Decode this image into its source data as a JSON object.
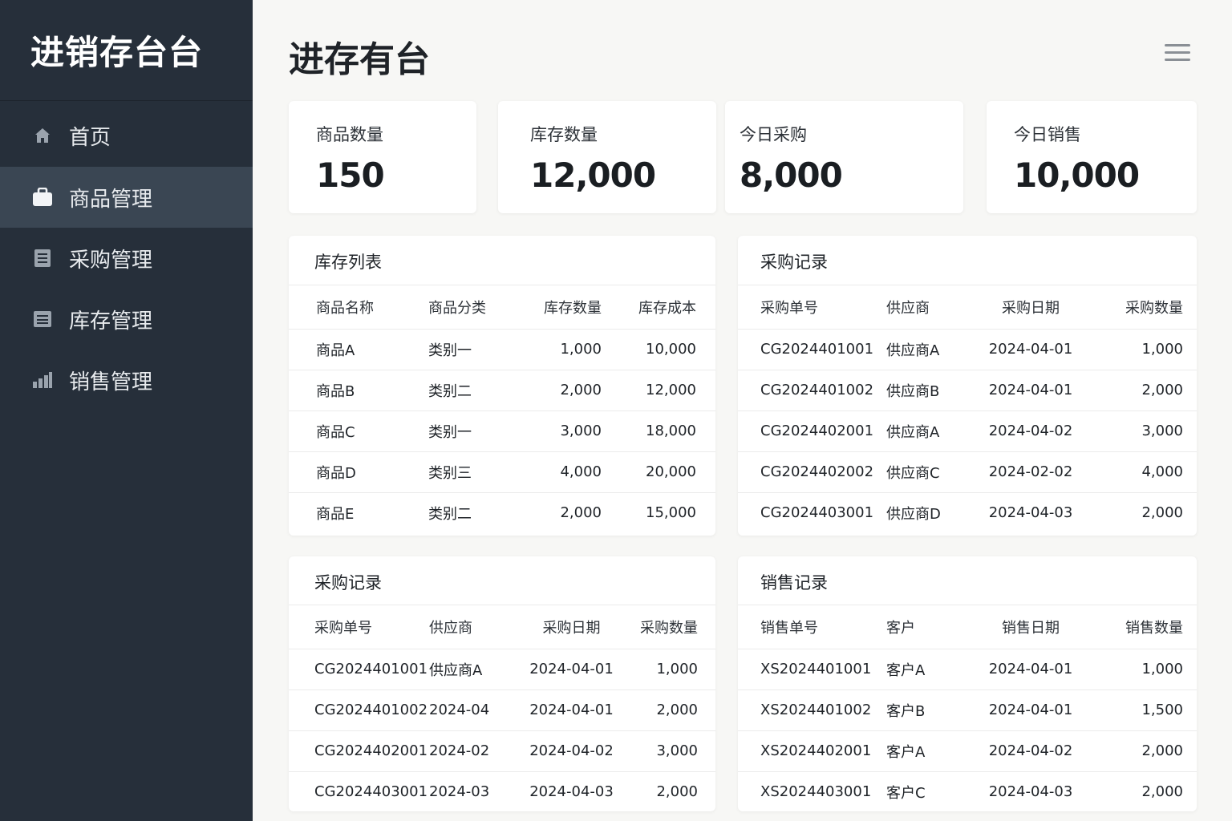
{
  "sidebar": {
    "brand": "进销存台台",
    "items": [
      {
        "label": "首页",
        "icon": "home-icon"
      },
      {
        "label": "商品管理",
        "icon": "briefcase-icon"
      },
      {
        "label": "采购管理",
        "icon": "document-icon"
      },
      {
        "label": "库存管理",
        "icon": "box-icon"
      },
      {
        "label": "销售管理",
        "icon": "bar-chart-icon"
      }
    ]
  },
  "header": {
    "title": "进存有台",
    "menu_icon": "hamburger-menu-icon"
  },
  "stats": [
    {
      "label": "商品数量",
      "value": "150"
    },
    {
      "label": "库存数量",
      "value": "12,000"
    },
    {
      "label": "今日采购",
      "value": "8,000"
    },
    {
      "label": "今日销售",
      "value": "10,000"
    }
  ],
  "inventory": {
    "title": "库存列表",
    "headers": [
      "商品名称",
      "商品分类",
      "库存数量",
      "库存成本"
    ],
    "rows": [
      [
        "商品A",
        "类别一",
        "1,000",
        "10,000"
      ],
      [
        "商品B",
        "类别二",
        "2,000",
        "12,000"
      ],
      [
        "商品C",
        "类别一",
        "3,000",
        "18,000"
      ],
      [
        "商品D",
        "类别三",
        "4,000",
        "20,000"
      ],
      [
        "商品E",
        "类别二",
        "2,000",
        "15,000"
      ]
    ]
  },
  "purchase_top": {
    "title": "采购记录",
    "headers": [
      "采购单号",
      "供应商",
      "采购日期",
      "采购数量"
    ],
    "rows": [
      [
        "CG2024401001",
        "供应商A",
        "2024-04-01",
        "1,000"
      ],
      [
        "CG2024401002",
        "供应商B",
        "2024-04-01",
        "2,000"
      ],
      [
        "CG2024402001",
        "供应商A",
        "2024-04-02",
        "3,000"
      ],
      [
        "CG2024402002",
        "供应商C",
        "2024-02-02",
        "4,000"
      ],
      [
        "CG2024403001",
        "供应商D",
        "2024-04-03",
        "2,000"
      ]
    ]
  },
  "purchase_bottom": {
    "title": "采购记录",
    "headers": [
      "采购单号",
      "供应商",
      "采购日期",
      "采购数量"
    ],
    "rows": [
      [
        "CG2024401001",
        "供应商A",
        "2024-04-01",
        "1,000"
      ],
      [
        "CG2024401002",
        "2024-04",
        "2024-04-01",
        "2,000"
      ],
      [
        "CG2024402001",
        "2024-02",
        "2024-04-02",
        "3,000"
      ],
      [
        "CG2024403001",
        "2024-03",
        "2024-04-03",
        "2,000"
      ]
    ]
  },
  "sales": {
    "title": "销售记录",
    "headers": [
      "销售单号",
      "客户",
      "销售日期",
      "销售数量"
    ],
    "rows": [
      [
        "XS2024401001",
        "客户A",
        "2024-04-01",
        "1,000"
      ],
      [
        "XS2024401002",
        "客户B",
        "2024-04-01",
        "1,500"
      ],
      [
        "XS2024402001",
        "客户A",
        "2024-04-02",
        "2,000"
      ],
      [
        "XS2024403001",
        "客户C",
        "2024-04-03",
        "2,000"
      ]
    ]
  },
  "colors": {
    "sidebar_bg": "#262f3a",
    "sidebar_active": "#3a4653",
    "page_bg": "#f7f7f5",
    "card_bg": "#ffffff"
  }
}
